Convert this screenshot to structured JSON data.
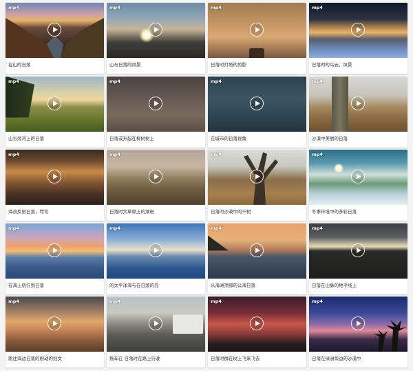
{
  "badge_label": "mp4",
  "videos": [
    {
      "title": "在山的日落"
    },
    {
      "title": "山与日落的风景"
    },
    {
      "title": "日落时灯塔的剪影"
    },
    {
      "title": "日落时的乌云、风景"
    },
    {
      "title": "山谷旁河上的日落"
    },
    {
      "title": "日落或升起在柳树树上"
    },
    {
      "title": "在城市的日落视角"
    },
    {
      "title": "沙漠中美丽的日落"
    },
    {
      "title": "海浪反射日落，特写"
    },
    {
      "title": "日落时大草原上的湖岩"
    },
    {
      "title": "日落时沙漠中的干树"
    },
    {
      "title": "冬季环境中的多彩日落"
    },
    {
      "title": "在海上航行到日落"
    },
    {
      "title": "的太平洋海与在日落的岛"
    },
    {
      "title": "从海滩顶部的公海日落"
    },
    {
      "title": "日落在山脉的地平线上"
    },
    {
      "title": "跑往海边日落的剧动的妇女"
    },
    {
      "title": "拖车在 日落时在路上行驶"
    },
    {
      "title": "日落时群在树上飞来飞去"
    },
    {
      "title": "日落在绿洲旁边的沙漠中"
    }
  ]
}
